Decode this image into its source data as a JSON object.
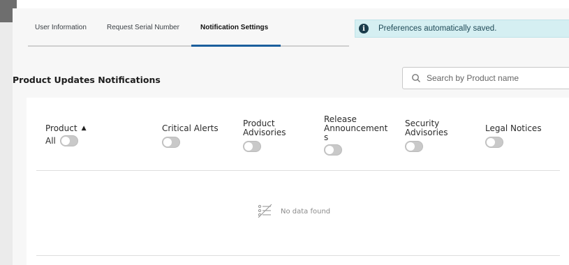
{
  "tabs": [
    {
      "label": "User Information",
      "active": false
    },
    {
      "label": "Request Serial Number",
      "active": false
    },
    {
      "label": "Notification Settings",
      "active": true
    }
  ],
  "toast": {
    "icon": "info-icon",
    "message": "Preferences automatically saved."
  },
  "section": {
    "title": "Product Updates Notifications"
  },
  "search": {
    "placeholder": "Search by Product name"
  },
  "columns": {
    "product": {
      "label": "Product",
      "sub": "All"
    },
    "critical": {
      "label": "Critical Alerts"
    },
    "advisories": {
      "label_line1": "Product",
      "label_line2": "Advisories"
    },
    "release": {
      "label_line1": "Release",
      "label_line2": "Announcement",
      "label_line3": "s"
    },
    "security": {
      "label_line1": "Security",
      "label_line2": "Advisories"
    },
    "legal": {
      "label": "Legal Notices"
    }
  },
  "empty_state": {
    "icon": "no-data-icon",
    "message": "No data found"
  },
  "colors": {
    "accent": "#1b5f9d",
    "toast_bg": "#d5eff2",
    "toggle_off": "#c9c9c9"
  }
}
